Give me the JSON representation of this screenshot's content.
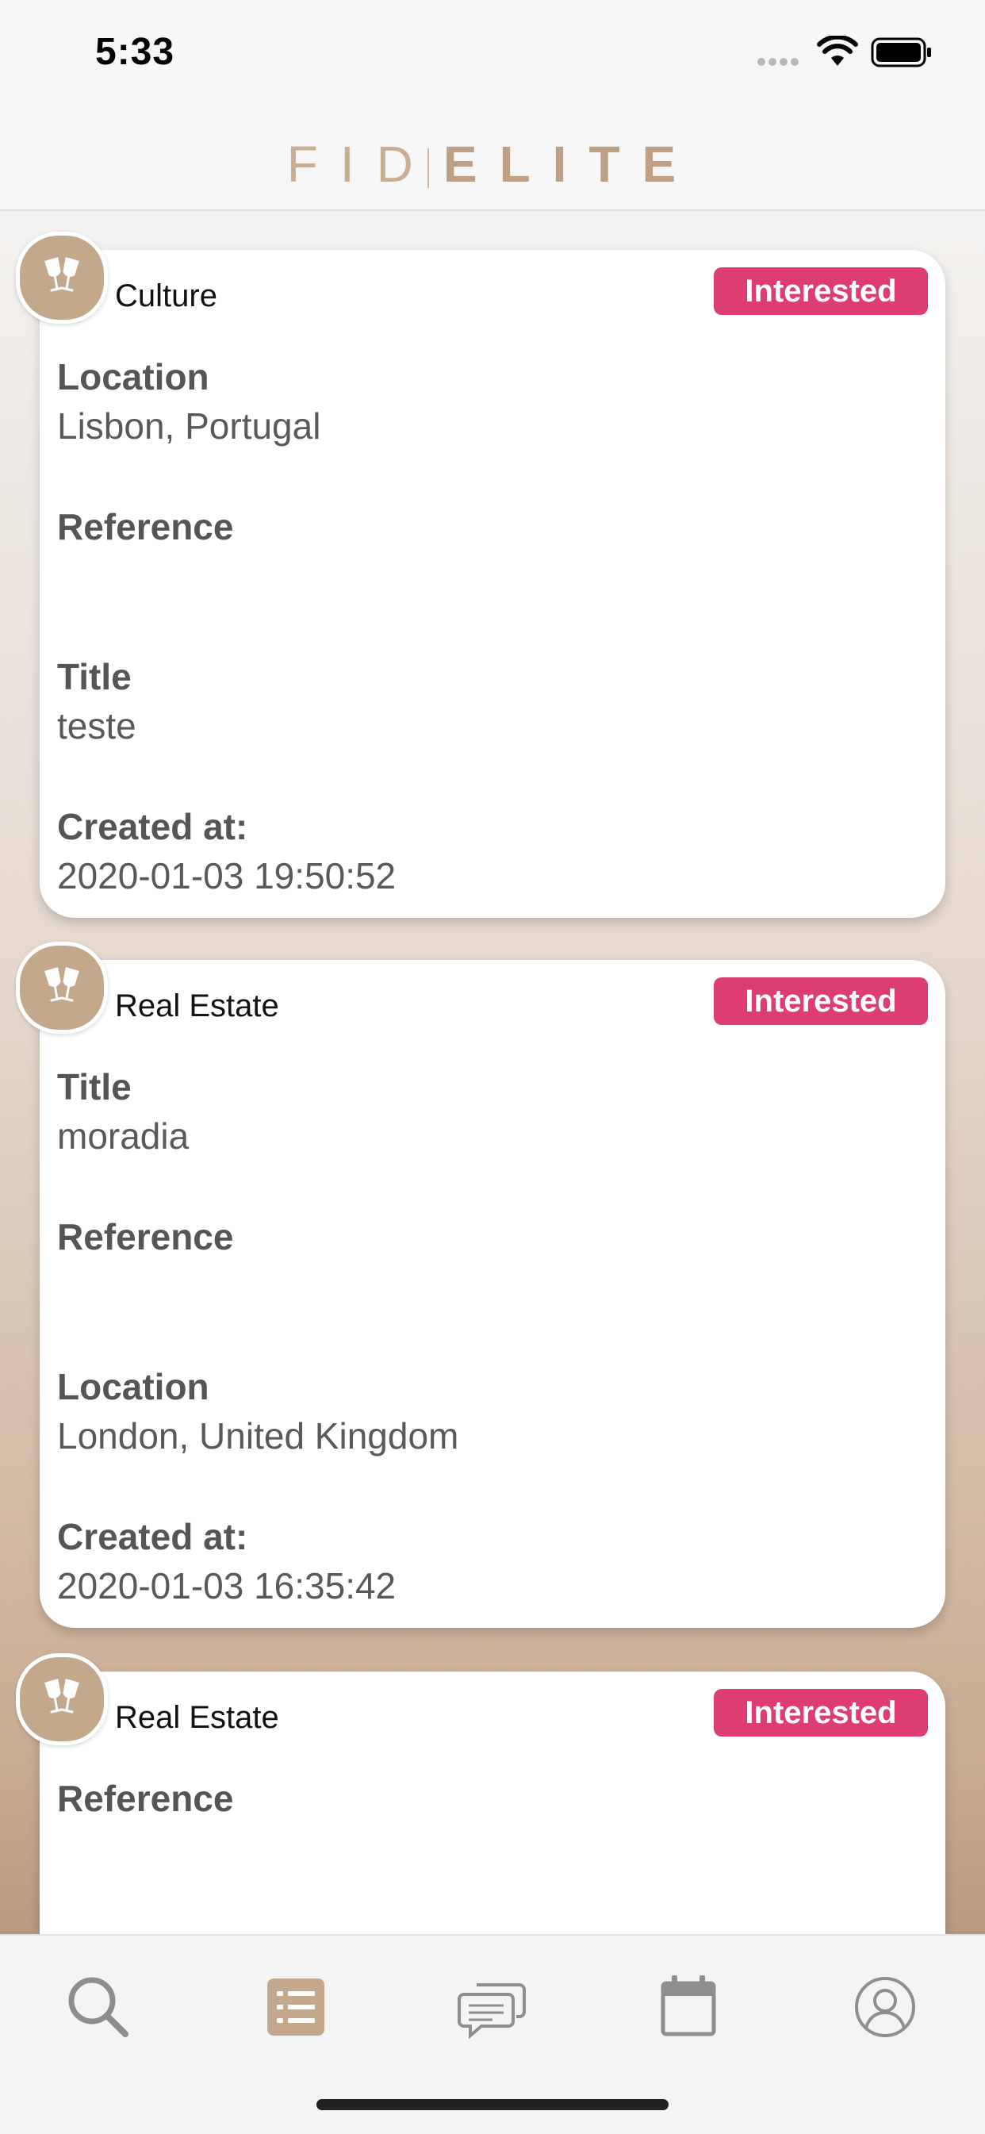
{
  "status_bar": {
    "time": "5:33"
  },
  "header": {
    "logo_light": "FID",
    "logo_bold": "ELITE"
  },
  "cards": [
    {
      "category": "Culture",
      "badge": "Interested",
      "fields": [
        {
          "label": "Location",
          "value": "Lisbon, Portugal"
        },
        {
          "label": "Reference",
          "value": ""
        },
        {
          "label": "Title",
          "value": "teste"
        },
        {
          "label": "Created at:",
          "value": "2020-01-03 19:50:52"
        }
      ]
    },
    {
      "category": "Real Estate",
      "badge": "Interested",
      "fields": [
        {
          "label": "Title",
          "value": "moradia"
        },
        {
          "label": "Reference",
          "value": ""
        },
        {
          "label": "Location",
          "value": "London, United Kingdom"
        },
        {
          "label": "Created at:",
          "value": "2020-01-03 16:35:42"
        }
      ]
    },
    {
      "category": "Real Estate",
      "badge": "Interested",
      "fields": [
        {
          "label": "Reference",
          "value": ""
        }
      ]
    }
  ],
  "tab_bar": {
    "tabs": [
      {
        "icon": "search-icon",
        "active": false
      },
      {
        "icon": "list-icon",
        "active": true
      },
      {
        "icon": "chat-icon",
        "active": false
      },
      {
        "icon": "calendar-icon",
        "active": false
      },
      {
        "icon": "profile-icon",
        "active": false
      }
    ]
  },
  "colors": {
    "accent": "#c3a88c",
    "badge": "#de3d73",
    "inactive_icon": "#8e8e8e"
  }
}
